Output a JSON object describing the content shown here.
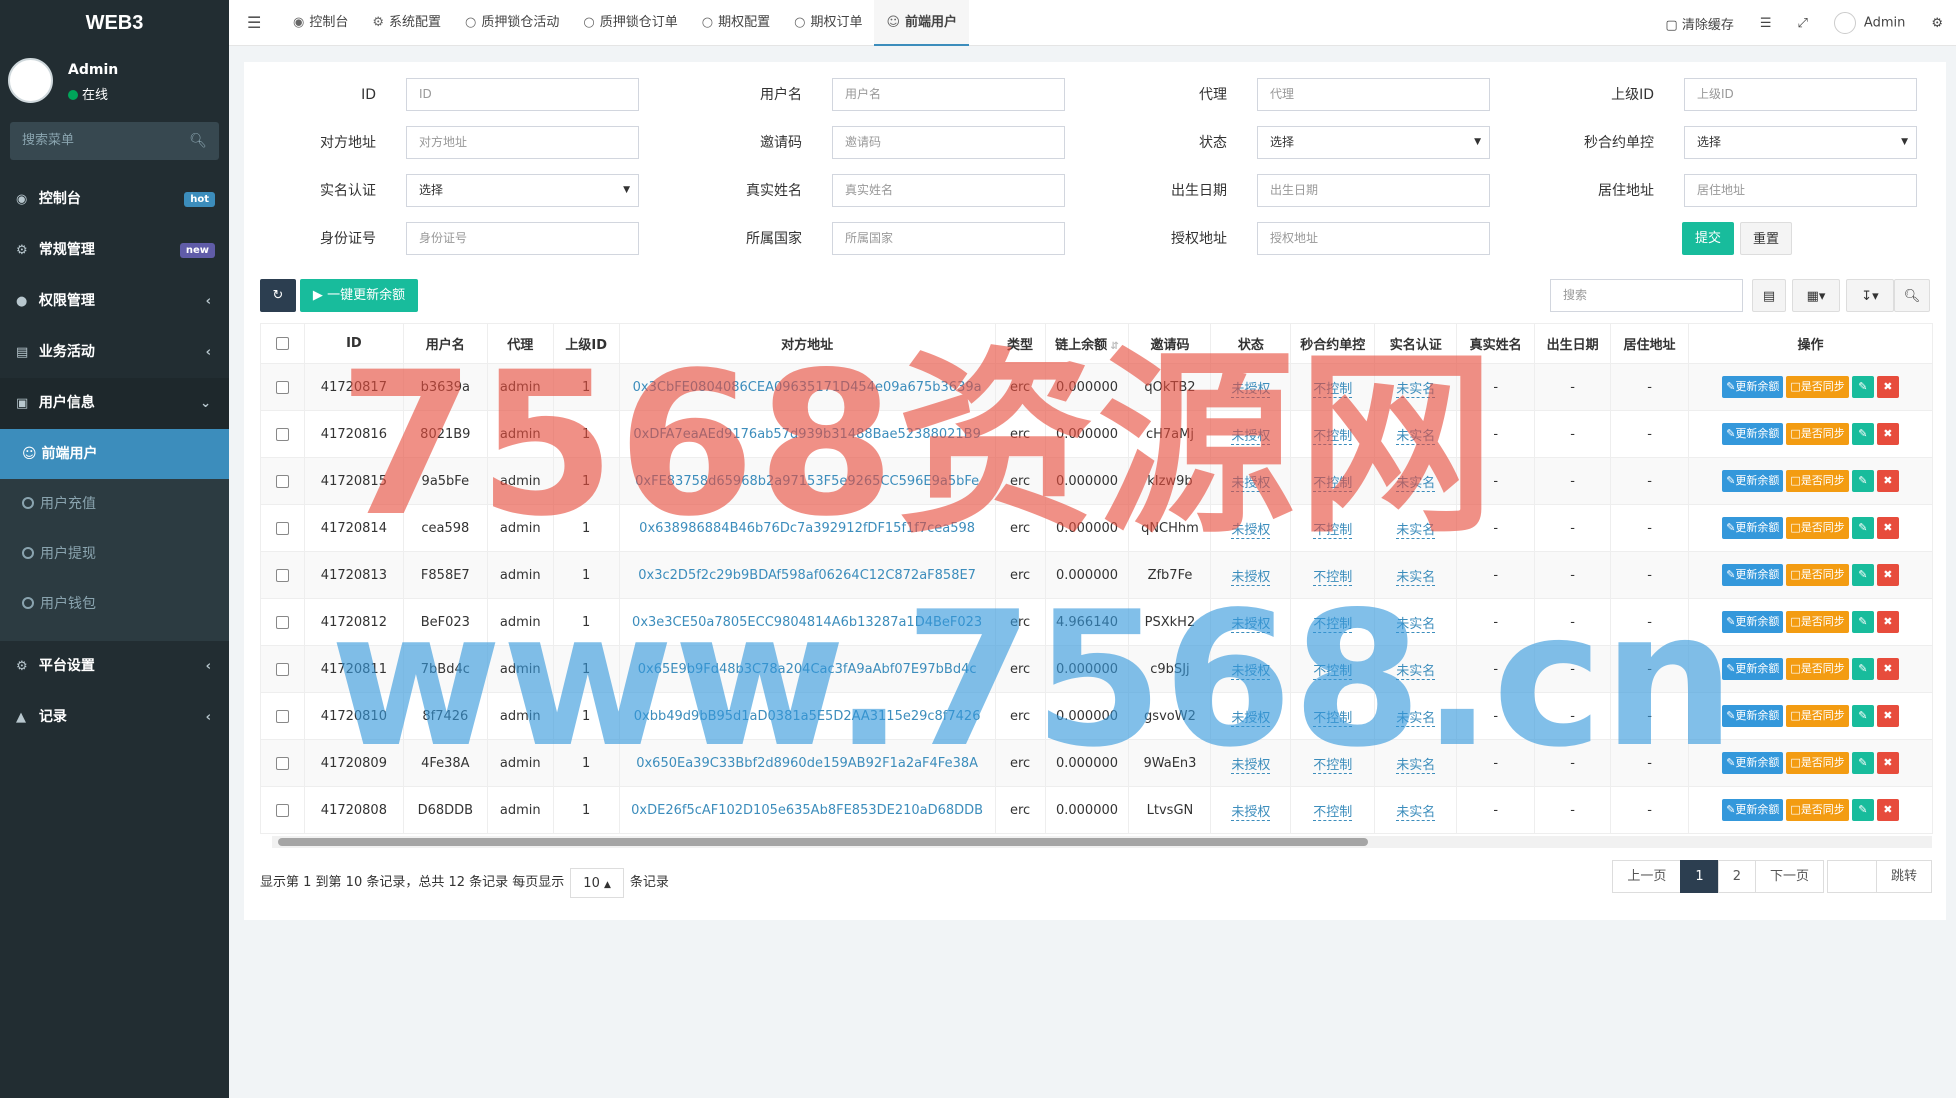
{
  "app": {
    "logo": "WEB3"
  },
  "user": {
    "name": "Admin",
    "status": "在线"
  },
  "sidebar": {
    "search_placeholder": "搜索菜单",
    "items": [
      {
        "label": "控制台",
        "badge": "hot"
      },
      {
        "label": "常规管理",
        "badge": "new"
      },
      {
        "label": "权限管理"
      },
      {
        "label": "业务活动"
      },
      {
        "label": "用户信息"
      },
      {
        "label": "前端用户"
      },
      {
        "label": "用户充值"
      },
      {
        "label": "用户提现"
      },
      {
        "label": "用户钱包"
      },
      {
        "label": "平台设置"
      },
      {
        "label": "记录"
      }
    ]
  },
  "tabs": [
    "控制台",
    "系统配置",
    "质押锁仓活动",
    "质押锁仓订单",
    "期权配置",
    "期权订单",
    "前端用户"
  ],
  "topright": {
    "clear_cache": "清除缓存",
    "admin": "Admin"
  },
  "filters": {
    "id": {
      "label": "ID",
      "placeholder": "ID"
    },
    "username": {
      "label": "用户名",
      "placeholder": "用户名"
    },
    "agent": {
      "label": "代理",
      "placeholder": "代理"
    },
    "parent_id": {
      "label": "上级ID",
      "placeholder": "上级ID"
    },
    "address": {
      "label": "对方地址",
      "placeholder": "对方地址"
    },
    "invite": {
      "label": "邀请码",
      "placeholder": "邀请码"
    },
    "status": {
      "label": "状态",
      "value": "选择"
    },
    "second_ctrl": {
      "label": "秒合约单控",
      "value": "选择"
    },
    "realname_auth": {
      "label": "实名认证",
      "value": "选择"
    },
    "realname": {
      "label": "真实姓名",
      "placeholder": "真实姓名"
    },
    "birth": {
      "label": "出生日期",
      "placeholder": "出生日期"
    },
    "residence": {
      "label": "居住地址",
      "placeholder": "居住地址"
    },
    "idcard": {
      "label": "身份证号",
      "placeholder": "身份证号"
    },
    "country": {
      "label": "所属国家",
      "placeholder": "所属国家"
    },
    "auth_addr": {
      "label": "授权地址",
      "placeholder": "授权地址"
    },
    "submit": "提交",
    "reset": "重置"
  },
  "toolbar": {
    "update_all": "一键更新余额",
    "search_placeholder": "搜索"
  },
  "table": {
    "headers": [
      "ID",
      "用户名",
      "代理",
      "上级ID",
      "对方地址",
      "类型",
      "链上余额",
      "邀请码",
      "状态",
      "秒合约单控",
      "实名认证",
      "真实姓名",
      "出生日期",
      "居住地址",
      "操作"
    ],
    "op_update": "更新余额",
    "op_sync": "是否同步",
    "rows": [
      {
        "id": "41720817",
        "username": "b3639a",
        "agent": "admin",
        "parent": "1",
        "address": "0x3CbFE0804086CEA09635171D454e09a675b3639a",
        "type": "erc",
        "balance": "0.000000",
        "invite": "qOkTB2",
        "status": "未授权",
        "ctrl": "不控制",
        "auth": "未实名",
        "realname": "-",
        "birth": "-",
        "residence": "-"
      },
      {
        "id": "41720816",
        "username": "8021B9",
        "agent": "admin",
        "parent": "1",
        "address": "0xDFA7eaAEd9176ab57d939b31488Bae52388021B9",
        "type": "erc",
        "balance": "0.000000",
        "invite": "cH7aMj",
        "status": "未授权",
        "ctrl": "不控制",
        "auth": "未实名",
        "realname": "-",
        "birth": "-",
        "residence": "-"
      },
      {
        "id": "41720815",
        "username": "9a5bFe",
        "agent": "admin",
        "parent": "1",
        "address": "0xFE83758d65968b2a97153F5e9265CC596E9a5bFe",
        "type": "erc",
        "balance": "0.000000",
        "invite": "kIzw9b",
        "status": "未授权",
        "ctrl": "不控制",
        "auth": "未实名",
        "realname": "-",
        "birth": "-",
        "residence": "-"
      },
      {
        "id": "41720814",
        "username": "cea598",
        "agent": "admin",
        "parent": "1",
        "address": "0x638986884B46b76Dc7a392912fDF15f1f7cea598",
        "type": "erc",
        "balance": "0.000000",
        "invite": "qNCHhm",
        "status": "未授权",
        "ctrl": "不控制",
        "auth": "未实名",
        "realname": "-",
        "birth": "-",
        "residence": "-"
      },
      {
        "id": "41720813",
        "username": "F858E7",
        "agent": "admin",
        "parent": "1",
        "address": "0x3c2D5f2c29b9BDAf598af06264C12C872aF858E7",
        "type": "erc",
        "balance": "0.000000",
        "invite": "Zfb7Fe",
        "status": "未授权",
        "ctrl": "不控制",
        "auth": "未实名",
        "realname": "-",
        "birth": "-",
        "residence": "-"
      },
      {
        "id": "41720812",
        "username": "BeF023",
        "agent": "admin",
        "parent": "1",
        "address": "0x3e3CE50a7805ECC9804814A6b13287a1D4BeF023",
        "type": "erc",
        "balance": "4.966140",
        "invite": "PSXkH2",
        "status": "未授权",
        "ctrl": "不控制",
        "auth": "未实名",
        "realname": "-",
        "birth": "-",
        "residence": "-"
      },
      {
        "id": "41720811",
        "username": "7bBd4c",
        "agent": "admin",
        "parent": "1",
        "address": "0x65E9b9Fd48b3C78a204Cac3fA9aAbf07E97bBd4c",
        "type": "erc",
        "balance": "0.000000",
        "invite": "c9bSJj",
        "status": "未授权",
        "ctrl": "不控制",
        "auth": "未实名",
        "realname": "-",
        "birth": "-",
        "residence": "-"
      },
      {
        "id": "41720810",
        "username": "8f7426",
        "agent": "admin",
        "parent": "1",
        "address": "0xbb49d9bB95d1aD0381a5E5D2AA3115e29c8f7426",
        "type": "erc",
        "balance": "0.000000",
        "invite": "gsvoW2",
        "status": "未授权",
        "ctrl": "不控制",
        "auth": "未实名",
        "realname": "-",
        "birth": "-",
        "residence": "-"
      },
      {
        "id": "41720809",
        "username": "4Fe38A",
        "agent": "admin",
        "parent": "1",
        "address": "0x650Ea39C33Bbf2d8960de159AB92F1a2aF4Fe38A",
        "type": "erc",
        "balance": "0.000000",
        "invite": "9WaEn3",
        "status": "未授权",
        "ctrl": "不控制",
        "auth": "未实名",
        "realname": "-",
        "birth": "-",
        "residence": "-"
      },
      {
        "id": "41720808",
        "username": "D68DDB",
        "agent": "admin",
        "parent": "1",
        "address": "0xDE26f5cAF102D105e635Ab8FE853DE210aD68DDB",
        "type": "erc",
        "balance": "0.000000",
        "invite": "LtvsGN",
        "status": "未授权",
        "ctrl": "不控制",
        "auth": "未实名",
        "realname": "-",
        "birth": "-",
        "residence": "-"
      }
    ]
  },
  "pagination": {
    "info_prefix": "显示第 1 到第 10 条记录，总共 12 条记录 每页显示",
    "page_size": "10",
    "info_suffix": "条记录",
    "prev": "上一页",
    "pages": [
      "1",
      "2"
    ],
    "next": "下一页",
    "jump": "跳转"
  },
  "watermark": {
    "line1": "7568资源网",
    "line2": "www.7568.cn"
  },
  "colors": {
    "sidebar": "#222d32",
    "active": "#3c8dbc",
    "green": "#18bc9c",
    "orange": "#f39c12",
    "red": "#e74c3c"
  }
}
